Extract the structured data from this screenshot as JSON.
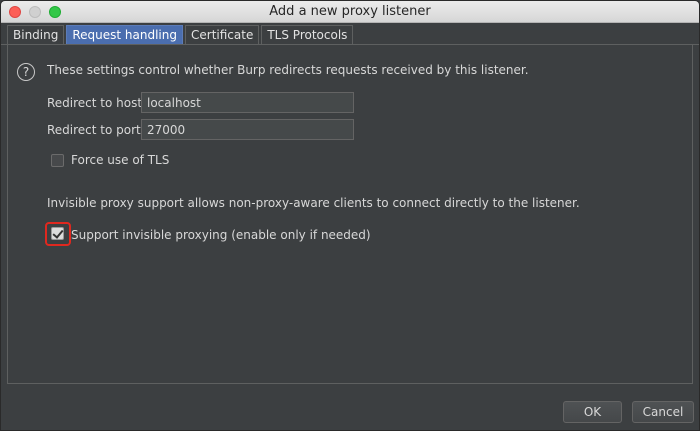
{
  "window": {
    "title": "Add a new proxy listener"
  },
  "tabs": [
    {
      "label": "Binding",
      "active": false
    },
    {
      "label": "Request handling",
      "active": true
    },
    {
      "label": "Certificate",
      "active": false
    },
    {
      "label": "TLS Protocols",
      "active": false
    }
  ],
  "request_handling": {
    "help_text": "These settings control whether Burp redirects requests received by this listener.",
    "redirect_host": {
      "label": "Redirect to host:",
      "value": "localhost"
    },
    "redirect_port": {
      "label": "Redirect to port:",
      "value": "27000"
    },
    "force_tls": {
      "label": "Force use of TLS",
      "checked": false
    },
    "invisible_info": "Invisible proxy support allows non-proxy-aware clients to connect directly to the listener.",
    "invisible_proxying": {
      "label": "Support invisible proxying (enable only if needed)",
      "checked": true
    }
  },
  "buttons": {
    "ok": "OK",
    "cancel": "Cancel"
  },
  "icons": {
    "help": "?"
  },
  "colors": {
    "accent": "#4b6eaf",
    "highlight": "#e0281f",
    "close": "#fc5f57",
    "maximize": "#33c748"
  }
}
